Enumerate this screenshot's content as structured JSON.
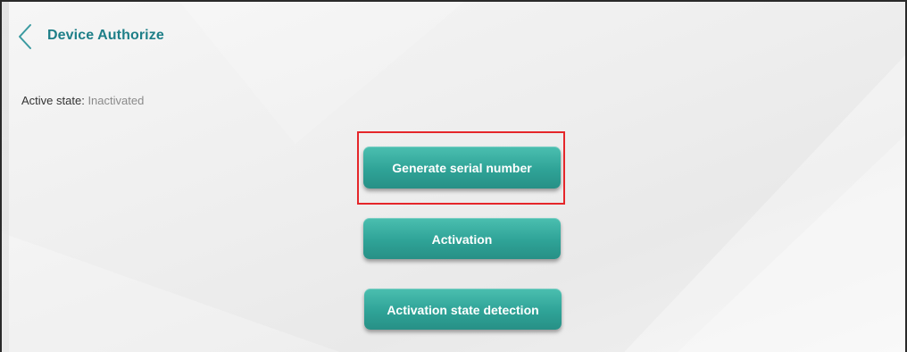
{
  "header": {
    "back_icon": "chevron-left-icon",
    "title": "Device Authorize"
  },
  "status": {
    "label": "Active state:",
    "value": "Inactivated"
  },
  "buttons": {
    "generate": "Generate serial number",
    "activate": "Activation",
    "detect": "Activation state detection"
  },
  "colors": {
    "accent": "#1e7f88",
    "button": "#2fa397",
    "highlight": "#e5262a"
  }
}
